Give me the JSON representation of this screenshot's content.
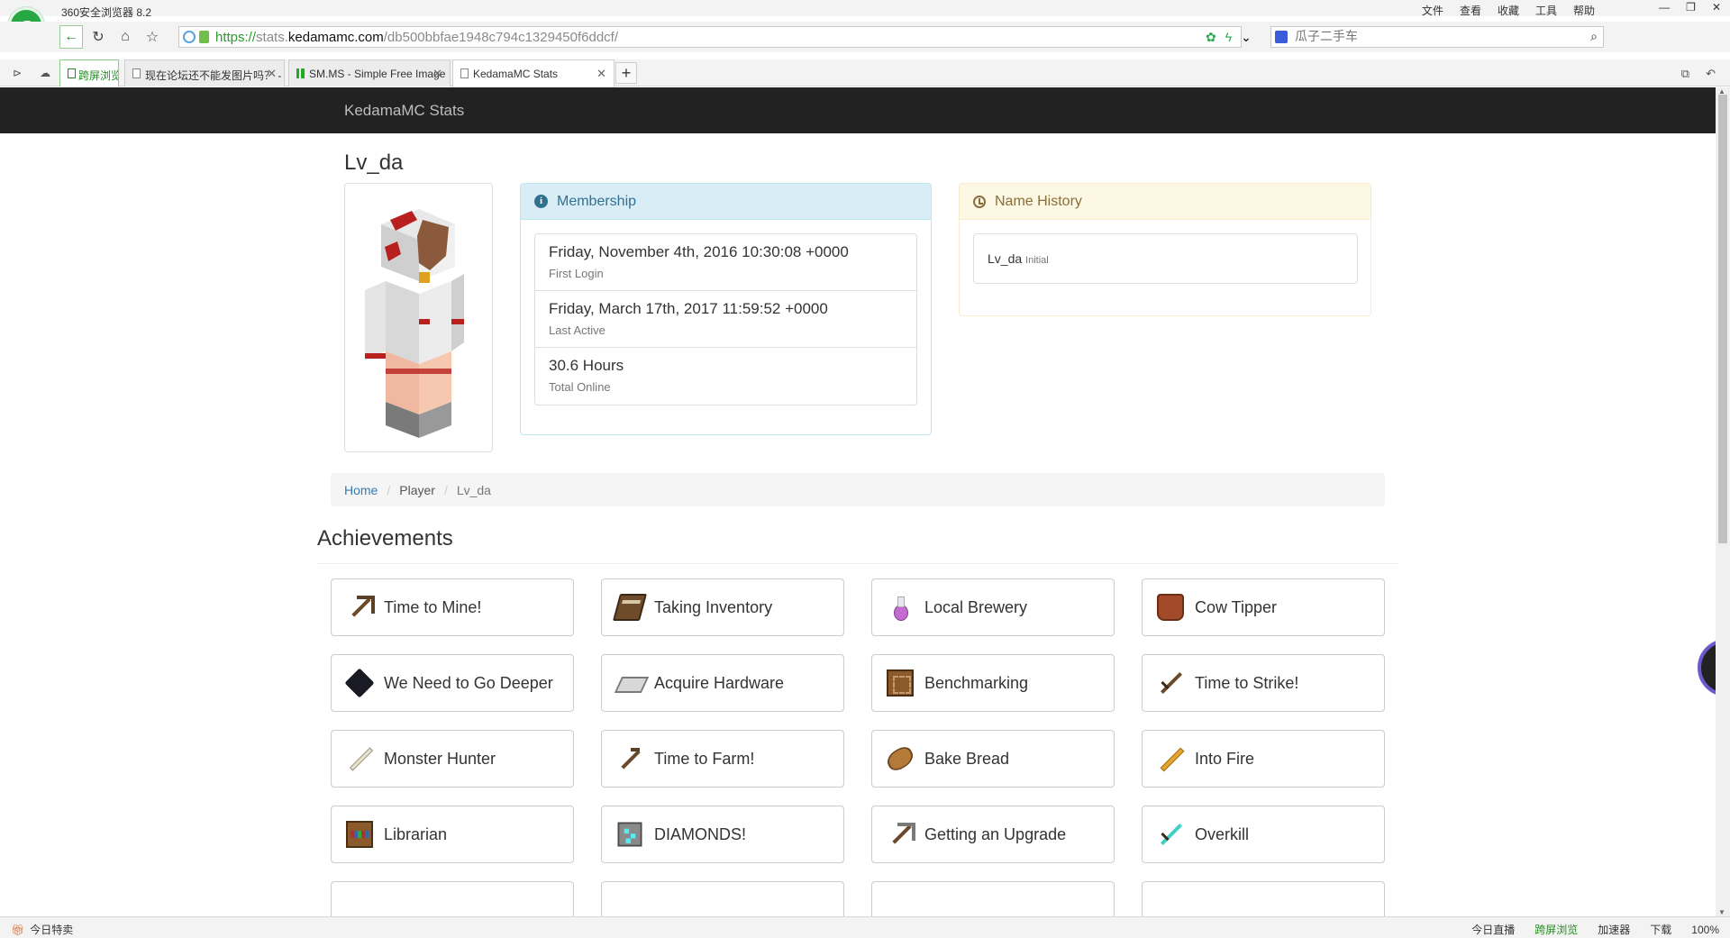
{
  "browser": {
    "title": "360安全浏览器 8.2",
    "menu": [
      "文件",
      "查看",
      "收藏",
      "工具",
      "帮助"
    ],
    "url": {
      "proto": "https://",
      "host_pre": "stats.",
      "host": "kedamamc.com",
      "path": "/db500bbfae1948c794c1329450f6ddcf/"
    },
    "search_placeholder": "瓜子二手车",
    "tabs": [
      {
        "label": "跨屏浏览"
      },
      {
        "label": "现在论坛还不能发图片吗？ - 毛"
      },
      {
        "label": "SM.MS - Simple Free Image"
      },
      {
        "label": "KedamaMC Stats"
      }
    ],
    "status_left": "今日特卖",
    "status_right": [
      "今日直播",
      "跨屏浏览",
      "加速器",
      "下载",
      "100%"
    ]
  },
  "site": {
    "brand": "KedamaMC Stats"
  },
  "player": {
    "name": "Lv_da"
  },
  "membership": {
    "title": "Membership",
    "items": [
      {
        "value": "Friday, November 4th, 2016 10:30:08 +0000",
        "label": "First Login"
      },
      {
        "value": "Friday, March 17th, 2017 11:59:52 +0000",
        "label": "Last Active"
      },
      {
        "value": "30.6 Hours",
        "label": "Total Online"
      }
    ]
  },
  "name_history": {
    "title": "Name History",
    "entries": [
      {
        "name": "Lv_da",
        "note": "Initial"
      }
    ]
  },
  "breadcrumb": {
    "home": "Home",
    "player": "Player",
    "current": "Lv_da"
  },
  "achievements": {
    "title": "Achievements",
    "items": [
      {
        "label": "Time to Mine!",
        "icon": "wooden-pickaxe-icon"
      },
      {
        "label": "Taking Inventory",
        "icon": "book-icon"
      },
      {
        "label": "Local Brewery",
        "icon": "potion-icon"
      },
      {
        "label": "Cow Tipper",
        "icon": "leather-icon"
      },
      {
        "label": "We Need to Go Deeper",
        "icon": "obsidian-icon"
      },
      {
        "label": "Acquire Hardware",
        "icon": "iron-ingot-icon"
      },
      {
        "label": "Benchmarking",
        "icon": "crafting-table-icon"
      },
      {
        "label": "Time to Strike!",
        "icon": "wooden-sword-icon"
      },
      {
        "label": "Monster Hunter",
        "icon": "bone-icon"
      },
      {
        "label": "Time to Farm!",
        "icon": "hoe-icon"
      },
      {
        "label": "Bake Bread",
        "icon": "bread-icon"
      },
      {
        "label": "Into Fire",
        "icon": "blaze-rod-icon"
      },
      {
        "label": "Librarian",
        "icon": "bookshelf-icon"
      },
      {
        "label": "DIAMONDS!",
        "icon": "diamond-ore-icon"
      },
      {
        "label": "Getting an Upgrade",
        "icon": "stone-pickaxe-icon"
      },
      {
        "label": "Overkill",
        "icon": "diamond-sword-icon"
      }
    ]
  }
}
